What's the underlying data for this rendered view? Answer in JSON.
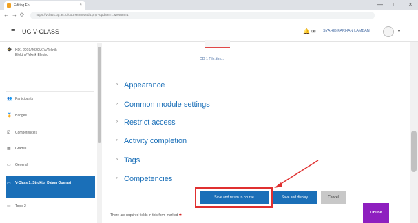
{
  "browser": {
    "tab_title": "Editing Fo",
    "close_glyph": "×",
    "url": "https://vclass.ug.ac.id/course/modedit.php?update=...&return=1",
    "win_min": "—",
    "win_max": "□",
    "win_close": "×",
    "back_glyph": "←",
    "fwd_glyph": "→",
    "reload_glyph": "⟳"
  },
  "navbar": {
    "hamburger": "≡",
    "site_name": "UG V-CLASS",
    "bell_glyph": "🔔",
    "msg_glyph": "✉",
    "user_name": "SYAHIB FARHAN LAMBAN",
    "caret": "▾"
  },
  "sidebar": {
    "course_info": "KD1 2019/2020/ATA/Teknik Elektro/Teknik Elektro",
    "items": [
      {
        "icon": "people-icon",
        "glyph": "👥",
        "label": "Participants"
      },
      {
        "icon": "badge-icon",
        "glyph": "🏅",
        "label": "Badges"
      },
      {
        "icon": "competencies-icon",
        "glyph": "☑",
        "label": "Competencies"
      },
      {
        "icon": "grades-icon",
        "glyph": "▦",
        "label": "Grades"
      },
      {
        "icon": "folder-icon",
        "glyph": "▭",
        "label": "General"
      }
    ],
    "active": {
      "glyph": "▭",
      "label": "V-Class 1: Struktur Dalam Operasi"
    },
    "next": {
      "glyph": "▭",
      "label": "Topic 2"
    }
  },
  "main": {
    "image_caption": "GD-1 File.doc...",
    "sections": [
      {
        "label": "Appearance"
      },
      {
        "label": "Common module settings"
      },
      {
        "label": "Restrict access"
      },
      {
        "label": "Activity completion"
      },
      {
        "label": "Tags"
      },
      {
        "label": "Competencies"
      }
    ],
    "caret_glyph": "›",
    "buttons": {
      "save_return": "Save and return to course",
      "save_display": "Save and display",
      "cancel": "Cancel"
    },
    "required_note": "There are required fields in this form marked",
    "online_label": "Online"
  },
  "colors": {
    "accent": "#1a6fb8",
    "highlight": "#e03030",
    "online": "#8e1fbf"
  }
}
